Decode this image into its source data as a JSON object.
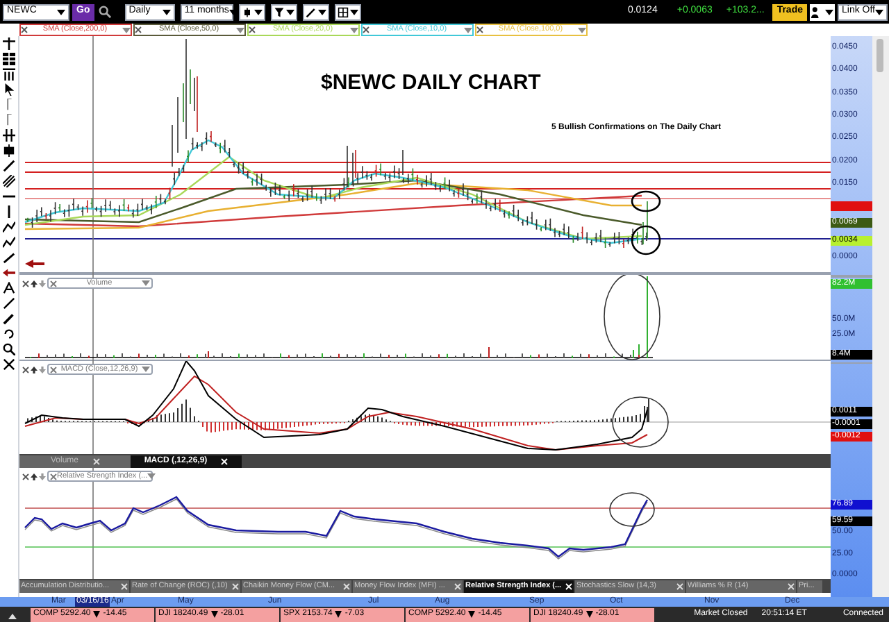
{
  "toolbar": {
    "symbol": "NEWC",
    "go": "Go",
    "interval": "Daily",
    "range": "11 months",
    "last": "0.0124",
    "change": "+0.0063",
    "change_pct": "+103.2...",
    "trade": "Trade",
    "link": "Link Off"
  },
  "indicator_tags": [
    {
      "label": "SMA (Close,200,0)",
      "color": "#d03a3a"
    },
    {
      "label": "SMA (Close,50,0)",
      "color": "#5a5a3a"
    },
    {
      "label": "SMA (Close,20,0)",
      "color": "#a8d858"
    },
    {
      "label": "SMA (Close,10,0)",
      "color": "#40c8d8"
    },
    {
      "label": "SMA (Close,100,0)",
      "color": "#e8c040"
    }
  ],
  "price_pane": {
    "title": "$NEWC DAILY CHART",
    "note": "5 Bullish Confirmations on The Daily Chart",
    "axis_labels": [
      "0.0450",
      "0.0400",
      "0.0350",
      "0.0300",
      "0.0250",
      "0.0200",
      "0.0150"
    ],
    "badges": [
      {
        "color": "#e01010"
      },
      {
        "text": "0.0069",
        "color": "#3c5a14"
      },
      {
        "text": "0.0034",
        "color": "#b8f030"
      }
    ],
    "axis_labels_low": [
      "0.0000"
    ]
  },
  "volume_pane": {
    "label": "Volume",
    "badges": [
      {
        "text": "82.2M",
        "color": "#30c030"
      },
      {
        "text": "8.4M",
        "color": "#000000"
      }
    ],
    "axis_labels": [
      "50.0M",
      "25.0M"
    ]
  },
  "macd_pane": {
    "label": "MACD (Close,12,26,9)",
    "badges": [
      {
        "text": "0.0011",
        "color": "#000000"
      },
      {
        "text": "-0.0001",
        "color": "#000000"
      },
      {
        "text": "-0.0012",
        "color": "#e01010"
      }
    ]
  },
  "macd_tabs": [
    {
      "label": "Volume",
      "selected": false
    },
    {
      "label": "MACD (,12,26,9)",
      "selected": true
    }
  ],
  "rsi_pane": {
    "label": "Relative Strength Index (...",
    "badges": [
      {
        "text": "76.89",
        "color": "#1010d0"
      },
      {
        "text": "59.59",
        "color": "#000000"
      }
    ],
    "axis_labels": [
      "50.00",
      "25.00",
      "0.0000"
    ]
  },
  "indicator_tabs": [
    {
      "label": "Accumulation Distributio...",
      "selected": false
    },
    {
      "label": "Rate of Change (ROC) (,10)",
      "selected": false
    },
    {
      "label": "Chaikin Money Flow (CM...",
      "selected": false
    },
    {
      "label": "Money Flow Index (MFI) ...",
      "selected": false
    },
    {
      "label": "Relative Strength Index (...",
      "selected": true
    },
    {
      "label": "Stochastics Slow (14,3)",
      "selected": false
    },
    {
      "label": "Williams % R (14)",
      "selected": false
    },
    {
      "label": "Pri...",
      "selected": false
    }
  ],
  "date_axis": [
    {
      "label": "Mar",
      "selected": false
    },
    {
      "label": "03/16/16",
      "selected": true
    },
    {
      "label": "Apr",
      "selected": false
    },
    {
      "label": "May",
      "selected": false
    },
    {
      "label": "Jun",
      "selected": false
    },
    {
      "label": "Jul",
      "selected": false
    },
    {
      "label": "Aug",
      "selected": false
    },
    {
      "label": "Sep",
      "selected": false
    },
    {
      "label": "Oct",
      "selected": false
    },
    {
      "label": "Nov",
      "selected": false
    },
    {
      "label": "Dec",
      "selected": false
    }
  ],
  "ticker": [
    {
      "symbol": "COMP",
      "price": "5292.40",
      "change": "-14.45"
    },
    {
      "symbol": "DJI",
      "price": "18240.49",
      "change": "-28.01"
    },
    {
      "symbol": "SPX",
      "price": "2153.74",
      "change": "-7.03"
    },
    {
      "symbol": "COMP",
      "price": "5292.40",
      "change": "-14.45"
    },
    {
      "symbol": "DJI",
      "price": "18240.49",
      "change": "-28.01"
    }
  ],
  "status": {
    "market": "Market Closed",
    "time": "20:51:14 ET",
    "connection": "Connected"
  }
}
